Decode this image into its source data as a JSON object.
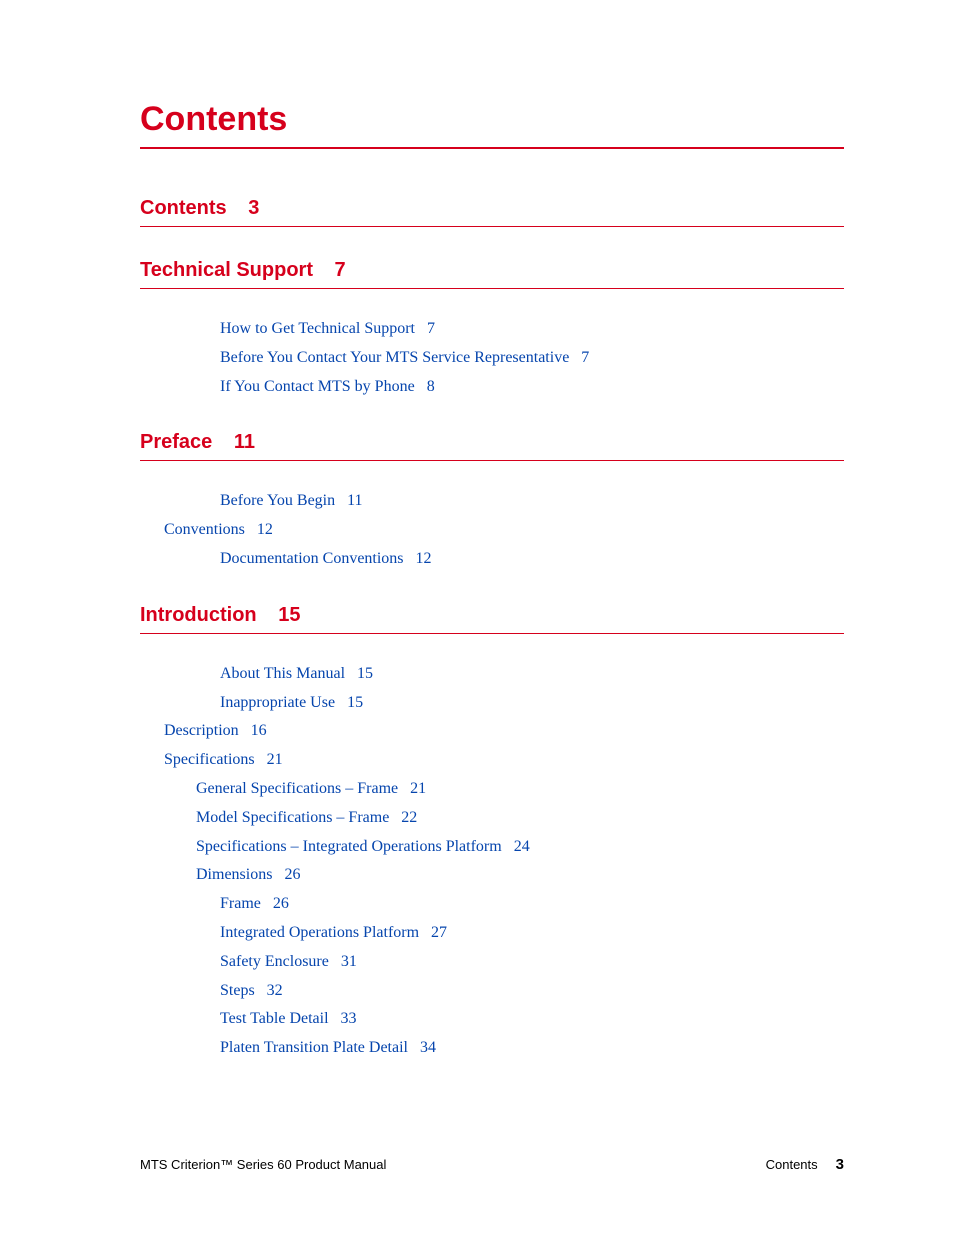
{
  "title": "Contents",
  "sections": [
    {
      "heading": "Contents",
      "page": "3",
      "entries": []
    },
    {
      "heading": "Technical Support",
      "page": "7",
      "entries": [
        {
          "label": "How to Get Technical Support",
          "page": "7",
          "indent": 1
        },
        {
          "label": "Before You Contact Your MTS Service Representative",
          "page": "7",
          "indent": 1
        },
        {
          "label": "If You Contact MTS by Phone",
          "page": "8",
          "indent": 1
        }
      ]
    },
    {
      "heading": "Preface",
      "page": "11",
      "entries": [
        {
          "label": "Before You Begin",
          "page": "11",
          "indent": 1
        },
        {
          "label": "Conventions",
          "page": "12",
          "indent": 0
        },
        {
          "label": "Documentation Conventions",
          "page": "12",
          "indent": 1
        }
      ]
    },
    {
      "heading": "Introduction",
      "page": "15",
      "entries": [
        {
          "label": "About This Manual",
          "page": "15",
          "indent": 1
        },
        {
          "label": "Inappropriate Use",
          "page": "15",
          "indent": 1
        },
        {
          "label": "Description",
          "page": "16",
          "indent": 0
        },
        {
          "label": "Specifications",
          "page": "21",
          "indent": 0
        },
        {
          "label": "General Specifications – Frame",
          "page": "21",
          "indent": 2
        },
        {
          "label": "Model Specifications – Frame",
          "page": "22",
          "indent": 2
        },
        {
          "label": "Specifications – Integrated Operations Platform",
          "page": "24",
          "indent": 2
        },
        {
          "label": "Dimensions",
          "page": "26",
          "indent": 2
        },
        {
          "label": "Frame",
          "page": "26",
          "indent": 3
        },
        {
          "label": "Integrated Operations Platform",
          "page": "27",
          "indent": 3
        },
        {
          "label": "Safety Enclosure",
          "page": "31",
          "indent": 3
        },
        {
          "label": "Steps",
          "page": "32",
          "indent": 3
        },
        {
          "label": "Test Table Detail",
          "page": "33",
          "indent": 3
        },
        {
          "label": "Platen Transition Plate Detail",
          "page": "34",
          "indent": 3
        }
      ]
    }
  ],
  "footer": {
    "left": "MTS Criterion™ Series 60 Product Manual",
    "right_label": "Contents",
    "right_page": "3"
  }
}
